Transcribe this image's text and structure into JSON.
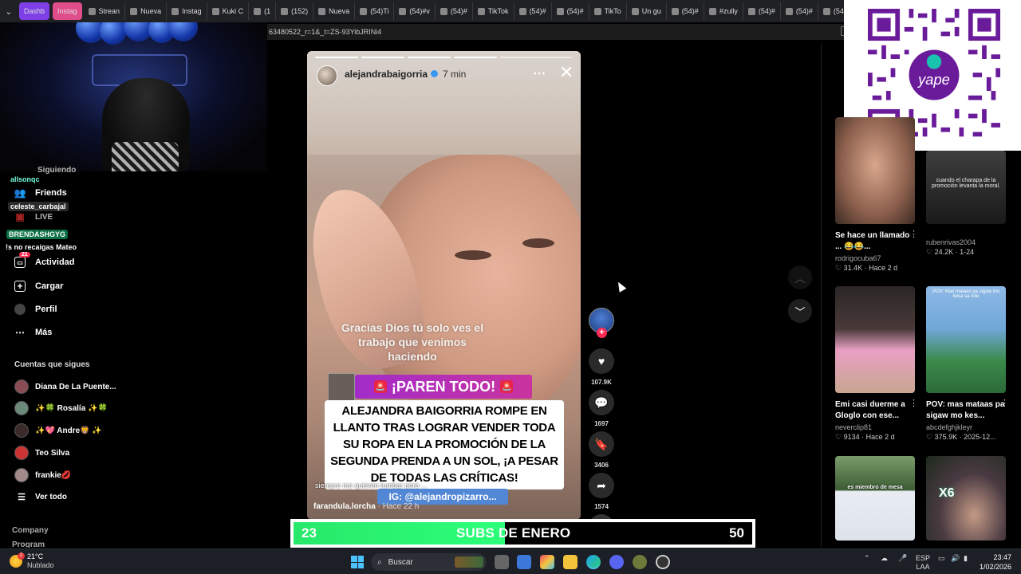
{
  "browser": {
    "tabs": [
      {
        "label": "Dashb",
        "style": "pill"
      },
      {
        "label": "Instag",
        "style": "pill2"
      },
      {
        "label": "Strean",
        "style": "normal"
      },
      {
        "label": "Nueva",
        "style": "normal"
      },
      {
        "label": "Instag",
        "style": "normal"
      },
      {
        "label": "Kuki C",
        "style": "normal"
      },
      {
        "label": "(1",
        "style": "normal"
      },
      {
        "label": "(152)",
        "style": "normal"
      },
      {
        "label": "Nueva",
        "style": "normal"
      },
      {
        "label": "(54)Ti",
        "style": "normal"
      },
      {
        "label": "(54)#v",
        "style": "normal"
      },
      {
        "label": "(54)#",
        "style": "normal"
      },
      {
        "label": "TikTok",
        "style": "normal"
      },
      {
        "label": "(54)#",
        "style": "normal"
      },
      {
        "label": "(54)#",
        "style": "normal"
      },
      {
        "label": "TikTo",
        "style": "normal"
      },
      {
        "label": "Un gu",
        "style": "normal"
      },
      {
        "label": "(54)#",
        "style": "normal"
      },
      {
        "label": "#zully",
        "style": "normal"
      },
      {
        "label": "(54)#",
        "style": "normal"
      },
      {
        "label": "(54)#",
        "style": "normal"
      },
      {
        "label": "(54)Yo",
        "style": "normal"
      },
      {
        "label": "(54)E",
        "style": "normal"
      }
    ],
    "url": "63480522_r=1&_t=ZS-93YibJRINi4"
  },
  "sidebar": {
    "overlay_tags": {
      "following_partial": "Siguiendo",
      "user1": "allsonqc",
      "user2": "celeste_carbajal",
      "user3": "BRENDASHGYG",
      "user3_msg": "!s no recaigas Mateo",
      "badge_count": "21"
    },
    "nav": [
      {
        "label": "Friends",
        "icon": "friends-icon"
      },
      {
        "label": "LIVE",
        "icon": "live-icon"
      },
      {
        "label": "Mensajes",
        "icon": "messages-icon"
      },
      {
        "label": "Actividad",
        "icon": "activity-icon"
      },
      {
        "label": "Cargar",
        "icon": "upload-icon"
      },
      {
        "label": "Perfil",
        "icon": "profile-icon"
      },
      {
        "label": "Más",
        "icon": "more-icon"
      }
    ],
    "following_title": "Cuentas que sigues",
    "accounts": [
      {
        "name": "Diana De La Puente..."
      },
      {
        "name": "✨🍀 Rosalía ✨🍀"
      },
      {
        "name": "✨💖 Andre🦁 ✨"
      },
      {
        "name": "Teo Silva"
      },
      {
        "name": "frankie💋"
      }
    ],
    "see_all": "Ver todo",
    "footer": [
      "Company",
      "Program"
    ]
  },
  "story": {
    "username": "alejandrabaigorria",
    "time": "7 min",
    "caption": "Gracias Dios tú solo ves el trabajo que venimos haciendo",
    "banner": "¡PAREN TODO!",
    "headline": "ALEJANDRA BAIGORRIA ROMPE EN LLANTO TRAS LOGRAR VENDER TODA SU ROPA EN LA PROMOCIÓN DE LA SEGUNDA PRENDA A UN SOL, ¡A PESAR DE TODAS LAS CRÍTICAS!",
    "small_caption": "siempre me quieren tumbar pero ...",
    "ig_tag": "IG: @alejandropizarro...",
    "source_user": "farandula.lorcha",
    "source_time": "· Hace 22 h"
  },
  "rail": {
    "likes": "107.9K",
    "comments": "1697",
    "saves": "3406",
    "shares": "1574"
  },
  "right_cards": [
    {
      "title": "Se hace un llamado ... 😂😂...",
      "user": "rodrigocuba67",
      "meta": "♡ 31.4K · Hace 2 d",
      "thumb": "talk"
    },
    {
      "title": "",
      "user": "rubenrivas2004",
      "meta": "♡ 24.2K · 1-24",
      "thumb": "dark",
      "overlay": "cuando el charapa de la promoción levanta la moral."
    },
    {
      "title": "Emi casi duerme a Gloglo con ese...",
      "user": "neverclip81",
      "meta": "♡ 9134 · Hace 2 d",
      "thumb": "room"
    },
    {
      "title": "POV: mas mataas pa sigaw mo kes...",
      "user": "abcdefghjkleyr",
      "meta": "♡ 375.9K · 2025-12...",
      "thumb": "park",
      "overlay": "POV: Mas mataas pa sigaw mo kesa sa ride"
    },
    {
      "title": "",
      "user": "",
      "meta": "",
      "thumb": "stream",
      "overlay": "es miembro de mesa"
    },
    {
      "title": "",
      "user": "",
      "meta": "",
      "thumb": "girl",
      "overlay": "X6"
    }
  ],
  "subs_goal": {
    "current": "23",
    "label": "SUBS DE ENERO",
    "goal": "50",
    "progress": 0.46
  },
  "taskbar": {
    "temp": "21°C",
    "condition": "Nublado",
    "weather_badge": "2",
    "search": "Buscar",
    "lang1": "ESP",
    "lang2": "LAA",
    "time": "23:47",
    "date": "1/02/2026"
  },
  "colors": {
    "accent_pink": "#fe2c55",
    "banner_purple": "#a22cc9",
    "goal_green": "#28e86a",
    "ig_blue": "#5287d6"
  }
}
